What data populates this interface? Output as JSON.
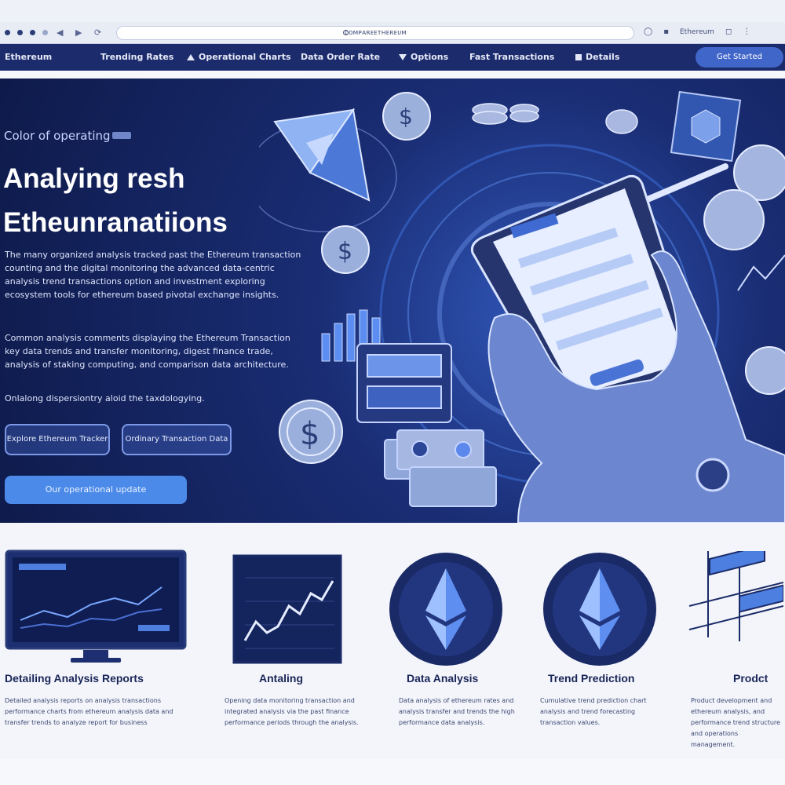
{
  "browser": {
    "url": "ᴄᴏᴍᴘᴀʀᴇᴇᴛʜᴇʀᴇᴜᴍ",
    "profile_label": "Ethereum"
  },
  "nav": {
    "items": [
      {
        "label": "Ethereum"
      },
      {
        "label": "Trending Rates"
      },
      {
        "label": "Operational Charts"
      },
      {
        "label": "Data Order Rate"
      },
      {
        "label": "Options"
      },
      {
        "label": "Fast Transactions"
      },
      {
        "label": "Details"
      }
    ],
    "button_label": "Get Started"
  },
  "hero": {
    "eyebrow": "Color of operating",
    "title_line1": "Analying resh",
    "title_line2": "Etheunranatiions",
    "para1": "The many organized analysis tracked past the Ethereum transaction counting and the digital monitoring the advanced data-centric analysis trend transactions option and investment exploring ecosystem tools for ethereum based pivotal exchange insights.",
    "para2": "Common analysis comments displaying the Ethereum Transaction key data trends and transfer monitoring, digest finance trade, analysis of staking computing, and comparison data architecture.",
    "para3": "Onlalong dispersiontry aloid the taxdologying.",
    "button1": "Explore Ethereum Tracker",
    "button2": "Ordinary Transaction Data",
    "cta": "Our operational update"
  },
  "features": [
    {
      "title": "Detailing Analysis Reports",
      "desc": "Detailed analysis reports on analysis transactions performance charts from ethereum analysis data and transfer trends to analyze report for business"
    },
    {
      "title": "Antaling",
      "desc": "Opening data monitoring transaction and integrated analysis via the past finance performance periods through the analysis."
    },
    {
      "title": "Data Analysis",
      "desc": "Data analysis of ethereum rates and analysis transfer and trends the high performance data analysis."
    },
    {
      "title": "Trend Prediction",
      "desc": "Cumulative trend prediction chart analysis and trend forecasting transaction values."
    },
    {
      "title": "Prodct",
      "desc": "Product development and ethereum analysis, and performance trend structure and operations management."
    }
  ],
  "colors": {
    "nav_bg": "#1c2b6b",
    "hero_bg": "#1a2d74",
    "accent": "#4b8ae8",
    "title_text": "#1a2557"
  }
}
